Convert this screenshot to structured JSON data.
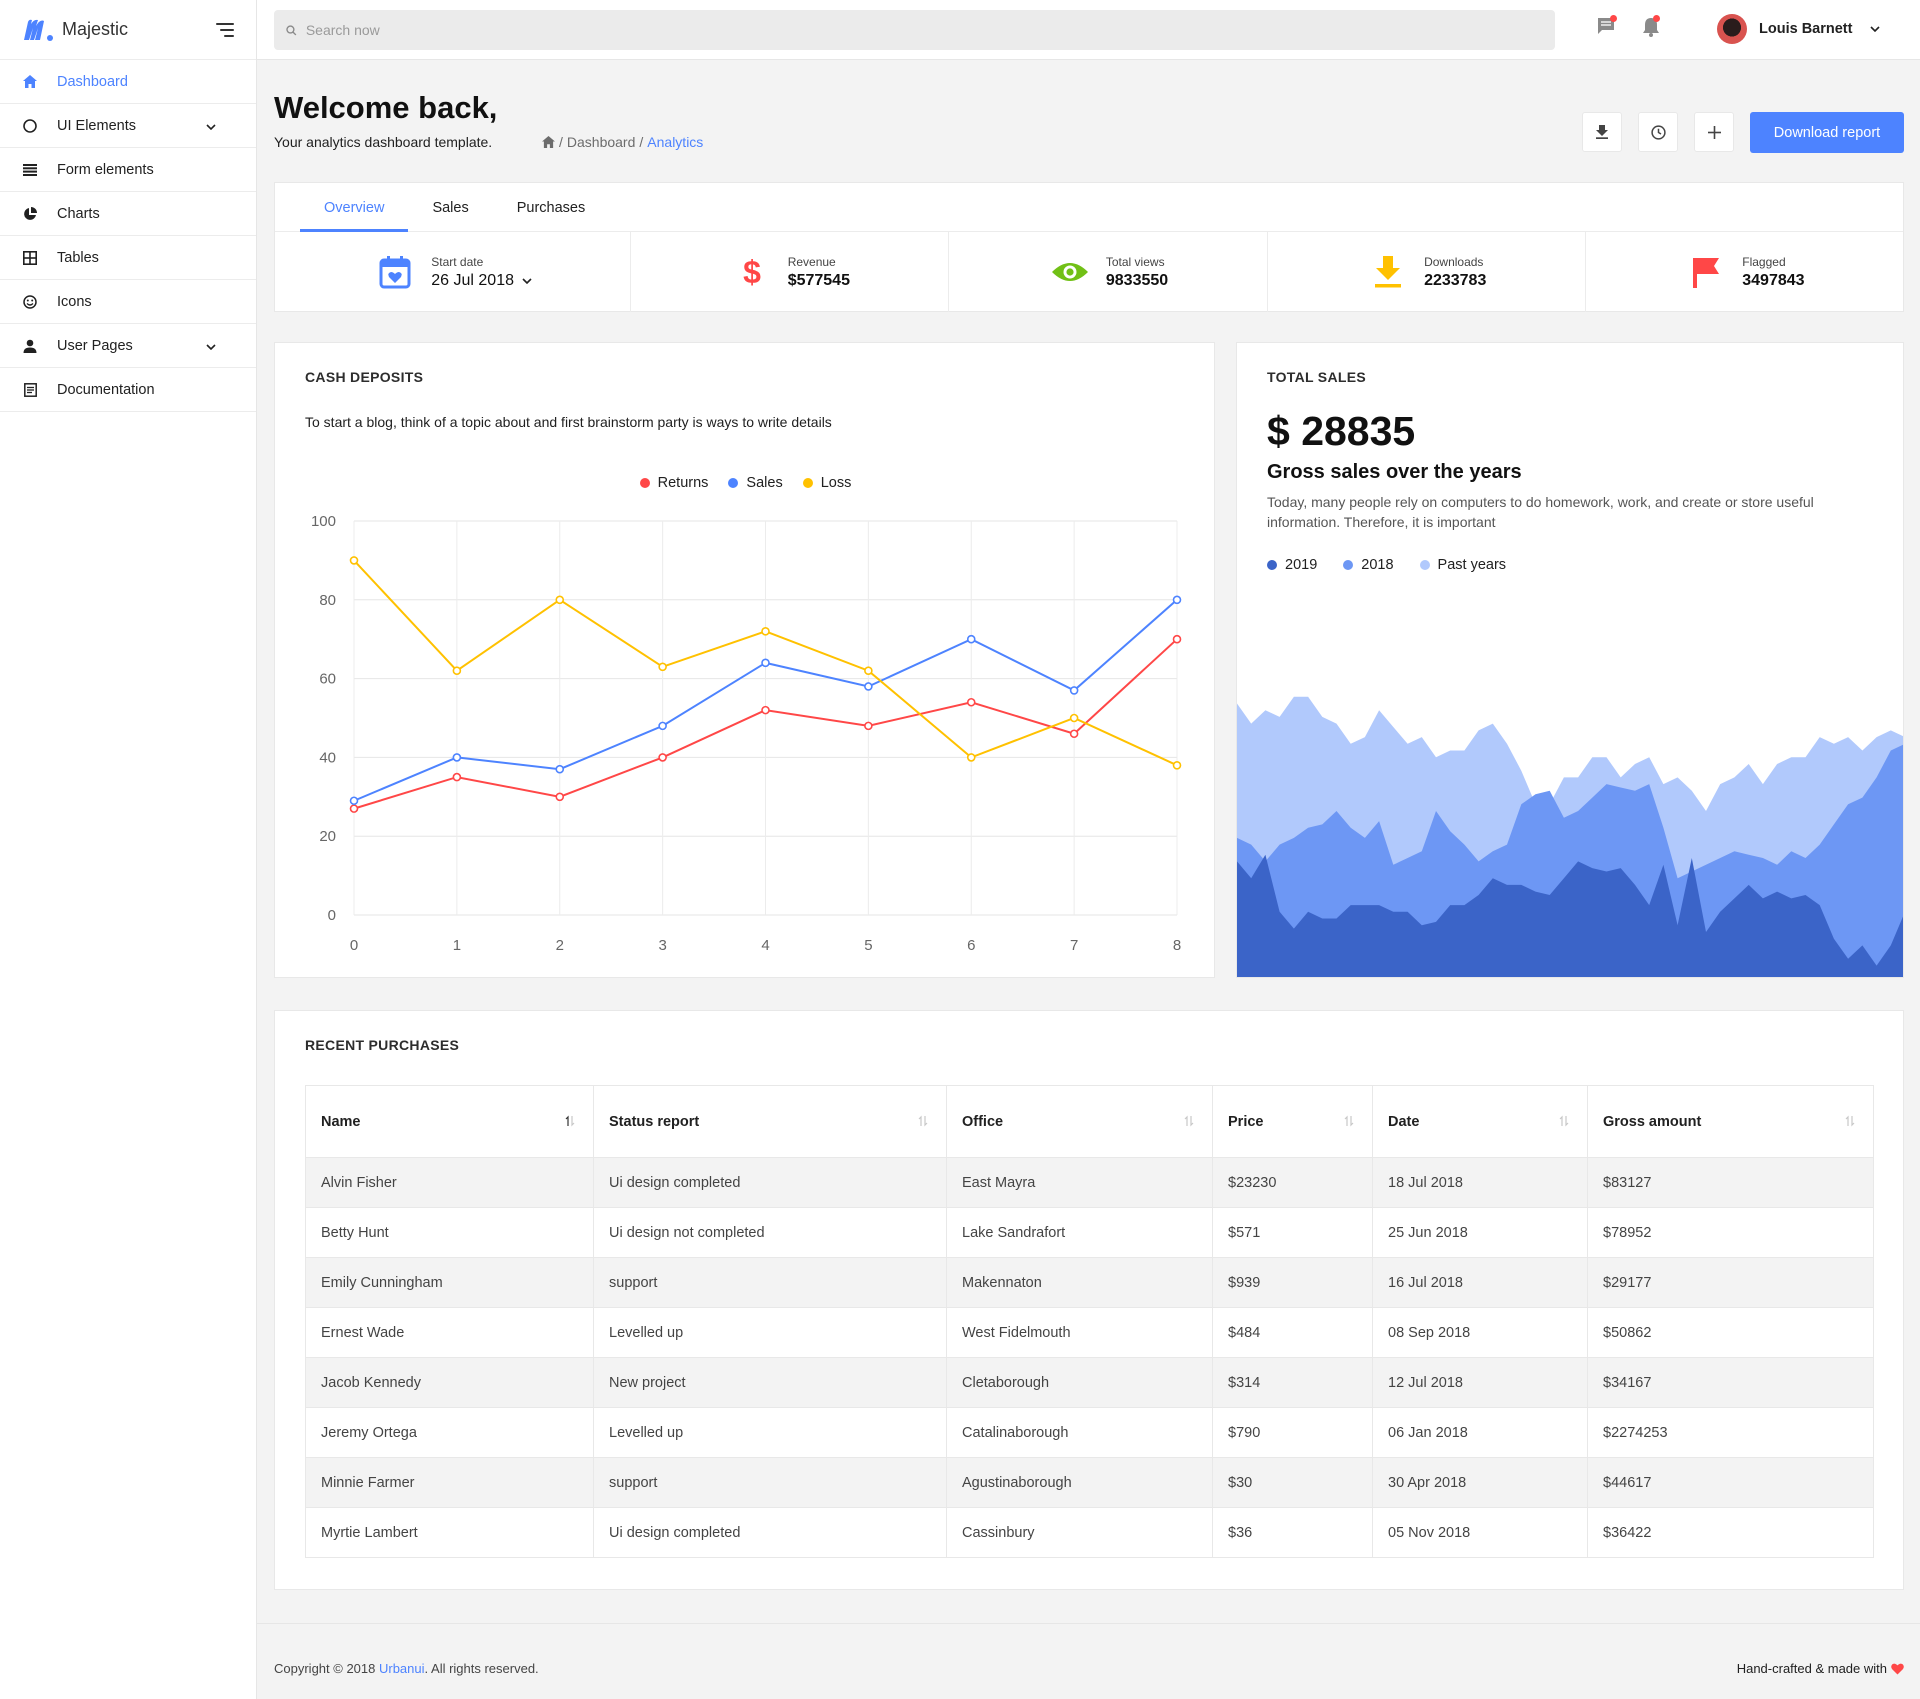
{
  "brand": {
    "name": "Majestic"
  },
  "sidebar": {
    "items": [
      {
        "label": "Dashboard",
        "icon": "home-icon",
        "active": true
      },
      {
        "label": "UI Elements",
        "icon": "circle-icon",
        "expandable": true
      },
      {
        "label": "Form elements",
        "icon": "list-icon"
      },
      {
        "label": "Charts",
        "icon": "pie-chart-icon"
      },
      {
        "label": "Tables",
        "icon": "grid-icon"
      },
      {
        "label": "Icons",
        "icon": "smiley-icon"
      },
      {
        "label": "User Pages",
        "icon": "user-icon",
        "expandable": true
      },
      {
        "label": "Documentation",
        "icon": "document-icon"
      }
    ]
  },
  "topbar": {
    "search_placeholder": "Search now",
    "user_name": "Louis Barnett"
  },
  "header": {
    "title": "Welcome back,",
    "subtitle": "Your analytics dashboard template.",
    "breadcrumb": [
      "Dashboard",
      "Analytics"
    ],
    "download_button": "Download report"
  },
  "tabs": [
    "Overview",
    "Sales",
    "Purchases"
  ],
  "stats": {
    "start_date_label": "Start date",
    "start_date_value": "26 Jul 2018",
    "items": [
      {
        "label": "Revenue",
        "value": "$577545",
        "icon": "dollar-icon",
        "color": "#ff4747"
      },
      {
        "label": "Total views",
        "value": "9833550",
        "icon": "eye-icon",
        "color": "#71c016"
      },
      {
        "label": "Downloads",
        "value": "2233783",
        "icon": "download-icon",
        "color": "#ffc100"
      },
      {
        "label": "Flagged",
        "value": "3497843",
        "icon": "flag-icon",
        "color": "#ff4747"
      }
    ]
  },
  "cash_deposits": {
    "title": "CASH DEPOSITS",
    "description": "To start a blog, think of a topic about and first brainstorm party is ways to write details"
  },
  "total_sales": {
    "title": "TOTAL SALES",
    "amount": "$ 28835",
    "subtitle": "Gross sales over the years",
    "description": "Today, many people rely on computers to do homework, work, and create or store useful information. Therefore, it is important"
  },
  "chart_data": [
    {
      "type": "line",
      "x": [
        0,
        1,
        2,
        3,
        4,
        5,
        6,
        7,
        8
      ],
      "ylim": [
        0,
        100
      ],
      "yticks": [
        0,
        20,
        40,
        60,
        80,
        100
      ],
      "grid": true,
      "legend_position": "top-center",
      "series": [
        {
          "name": "Returns",
          "color": "#ff4747",
          "values": [
            27,
            35,
            30,
            40,
            52,
            48,
            54,
            46,
            70
          ]
        },
        {
          "name": "Sales",
          "color": "#4d83ff",
          "values": [
            29,
            40,
            37,
            48,
            64,
            58,
            70,
            57,
            80
          ]
        },
        {
          "name": "Loss",
          "color": "#ffc100",
          "values": [
            90,
            62,
            80,
            63,
            72,
            62,
            40,
            50,
            38
          ]
        }
      ]
    },
    {
      "type": "area",
      "ylim": [
        0,
        100
      ],
      "grid": false,
      "legend_position": "top-left",
      "series": [
        {
          "name": "2019",
          "color": "#3b64c8",
          "values": [
            35,
            30,
            37,
            20,
            15,
            20,
            18,
            18,
            22,
            22,
            22,
            20,
            20,
            16,
            17,
            22,
            22,
            25,
            30,
            28,
            28,
            26,
            25,
            30,
            35,
            33,
            32,
            33,
            28,
            22,
            34,
            16,
            36,
            14,
            20,
            24,
            28,
            24,
            26,
            24,
            25,
            22,
            12,
            6,
            10,
            4,
            10,
            20
          ]
        },
        {
          "name": "2018",
          "color": "#6d97f4",
          "values": [
            42,
            40,
            35,
            40,
            42,
            45,
            46,
            50,
            45,
            42,
            47,
            34,
            36,
            38,
            50,
            44,
            40,
            35,
            38,
            40,
            52,
            55,
            56,
            48,
            50,
            54,
            58,
            57,
            56,
            58,
            45,
            30,
            32,
            34,
            36,
            38,
            37,
            36,
            34,
            38,
            36,
            40,
            46,
            52,
            54,
            60,
            68,
            70
          ]
        },
        {
          "name": "Past years",
          "color": "#b1c9fc",
          "values": [
            82,
            76,
            80,
            78,
            84,
            84,
            78,
            76,
            70,
            72,
            80,
            75,
            70,
            72,
            66,
            68,
            68,
            74,
            76,
            70,
            62,
            52,
            52,
            60,
            60,
            66,
            66,
            60,
            64,
            66,
            58,
            60,
            56,
            50,
            58,
            60,
            64,
            58,
            64,
            66,
            66,
            72,
            70,
            72,
            68,
            72,
            74,
            72
          ]
        }
      ]
    }
  ],
  "purchases": {
    "title": "RECENT PURCHASES",
    "columns": [
      "Name",
      "Status report",
      "Office",
      "Price",
      "Date",
      "Gross amount"
    ],
    "rows": [
      [
        "Alvin Fisher",
        "Ui design completed",
        "East Mayra",
        "$23230",
        "18 Jul 2018",
        "$83127"
      ],
      [
        "Betty Hunt",
        "Ui design not completed",
        "Lake Sandrafort",
        "$571",
        "25 Jun 2018",
        "$78952"
      ],
      [
        "Emily Cunningham",
        "support",
        "Makennaton",
        "$939",
        "16 Jul 2018",
        "$29177"
      ],
      [
        "Ernest Wade",
        "Levelled up",
        "West Fidelmouth",
        "$484",
        "08 Sep 2018",
        "$50862"
      ],
      [
        "Jacob Kennedy",
        "New project",
        "Cletaborough",
        "$314",
        "12 Jul 2018",
        "$34167"
      ],
      [
        "Jeremy Ortega",
        "Levelled up",
        "Catalinaborough",
        "$790",
        "06 Jan 2018",
        "$2274253"
      ],
      [
        "Minnie Farmer",
        "support",
        "Agustinaborough",
        "$30",
        "30 Apr 2018",
        "$44617"
      ],
      [
        "Myrtie Lambert",
        "Ui design completed",
        "Cassinbury",
        "$36",
        "05 Nov 2018",
        "$36422"
      ]
    ]
  },
  "footer": {
    "copyright_prefix": "Copyright © 2018",
    "company": "Urbanui",
    "copyright_suffix": ". All rights reserved.",
    "right_text": "Hand-crafted & made with"
  },
  "colors": {
    "accent": "#4d83ff",
    "danger": "#ff4747",
    "success": "#71c016",
    "warning": "#ffc100"
  }
}
